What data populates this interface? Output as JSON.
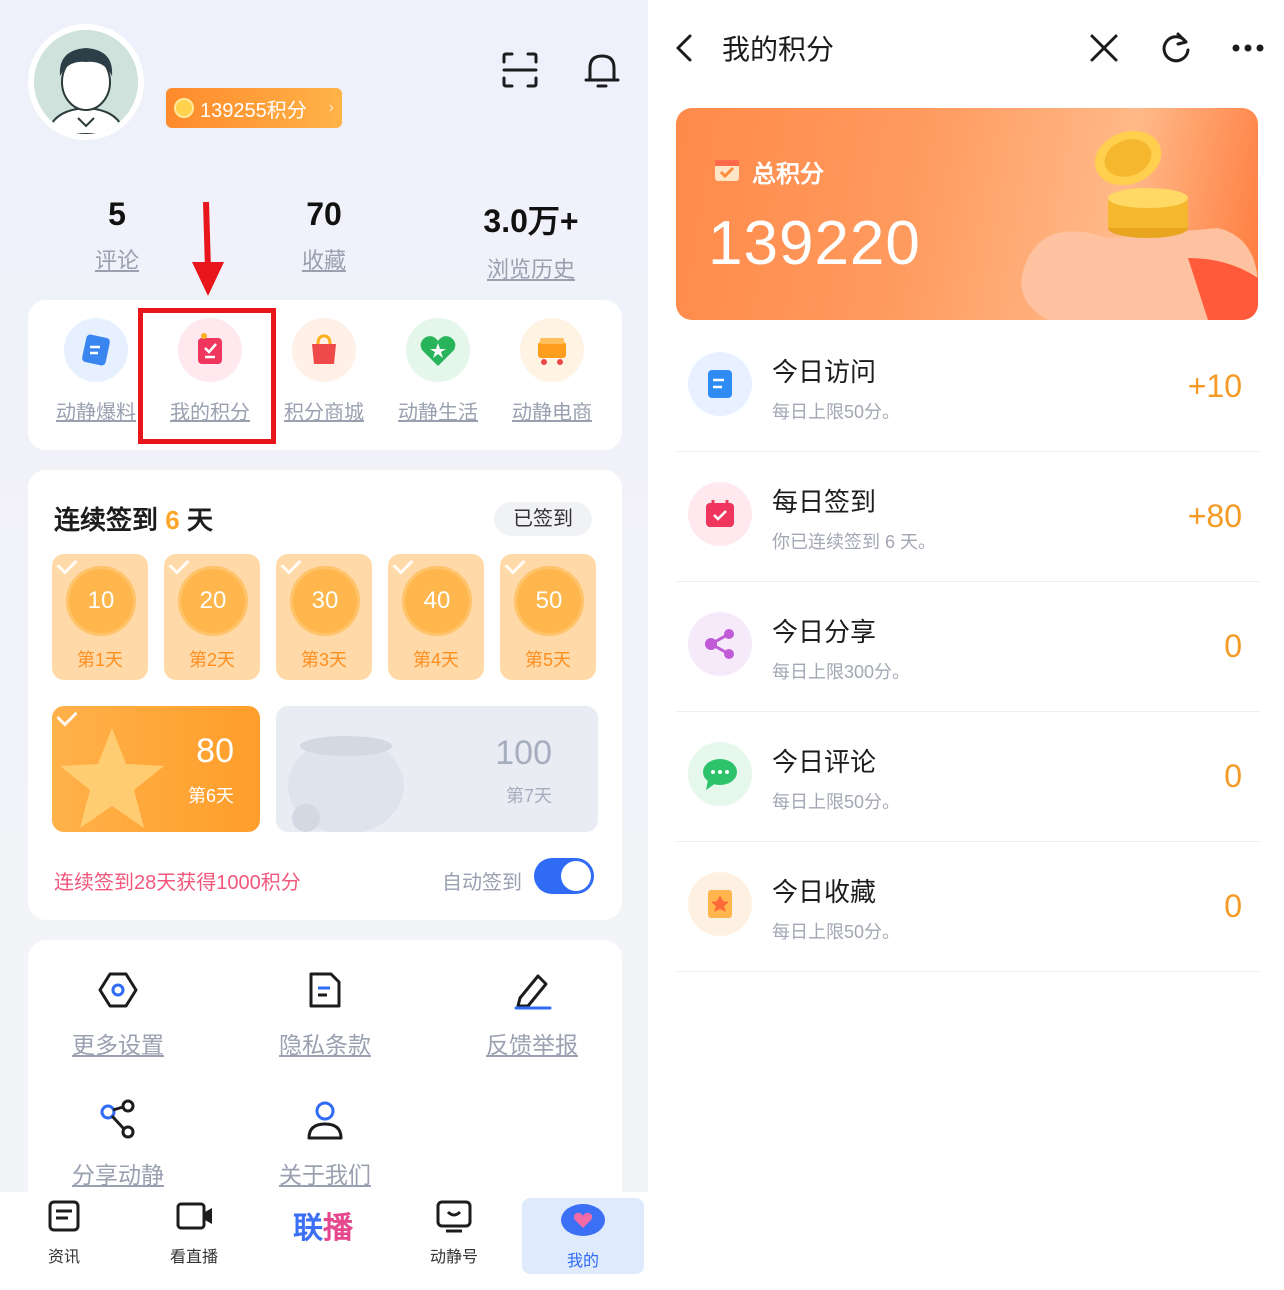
{
  "left": {
    "points_badge": "139255积分",
    "stats": [
      {
        "value": "5",
        "label": "评论"
      },
      {
        "value": "70",
        "label": "收藏"
      },
      {
        "value": "3.0万+",
        "label": "浏览历史"
      }
    ],
    "quick": [
      {
        "label": "动静爆料",
        "icon": "document-icon"
      },
      {
        "label": "我的积分",
        "icon": "points-icon"
      },
      {
        "label": "积分商城",
        "icon": "shopping-bag-icon"
      },
      {
        "label": "动静生活",
        "icon": "heart-star-icon"
      },
      {
        "label": "动静电商",
        "icon": "cart-icon"
      }
    ],
    "checkin": {
      "title_prefix": "连续签到",
      "days_count": "6",
      "title_suffix": "天",
      "signed_label": "已签到",
      "days": [
        {
          "value": "10",
          "label": "第1天"
        },
        {
          "value": "20",
          "label": "第2天"
        },
        {
          "value": "30",
          "label": "第3天"
        },
        {
          "value": "40",
          "label": "第4天"
        },
        {
          "value": "50",
          "label": "第5天"
        },
        {
          "value": "80",
          "label": "第6天"
        },
        {
          "value": "100",
          "label": "第7天"
        }
      ],
      "tip": "连续签到28天获得1000积分",
      "auto_label": "自动签到",
      "auto_on": true
    },
    "settings": [
      {
        "label": "更多设置",
        "icon": "hexagon-settings-icon"
      },
      {
        "label": "隐私条款",
        "icon": "document-icon"
      },
      {
        "label": "反馈举报",
        "icon": "pencil-icon"
      },
      {
        "label": "分享动静",
        "icon": "share-icon"
      },
      {
        "label": "关于我们",
        "icon": "person-icon"
      }
    ],
    "tabs": [
      {
        "label": "资讯"
      },
      {
        "label": "看直播"
      },
      {
        "label": "动静号"
      },
      {
        "label": "我的"
      }
    ],
    "lianbo": {
      "text1": "联",
      "text2": "播"
    }
  },
  "right": {
    "title": "我的积分",
    "total_label": "总积分",
    "total_value": "139220",
    "tasks": [
      {
        "name": "今日访问",
        "desc": "每日上限50分。",
        "value": "+10",
        "icon": "document-icon",
        "color": "#2f8cf5"
      },
      {
        "name": "每日签到",
        "desc": "你已连续签到 6 天。",
        "value": "+80",
        "icon": "calendar-icon",
        "color": "#f0365e"
      },
      {
        "name": "今日分享",
        "desc": "每日上限300分。",
        "value": "0",
        "icon": "share-icon",
        "color": "#c05ad6"
      },
      {
        "name": "今日评论",
        "desc": "每日上限50分。",
        "value": "0",
        "icon": "chat-icon",
        "color": "#2cc36b"
      },
      {
        "name": "今日收藏",
        "desc": "每日上限50分。",
        "value": "0",
        "icon": "star-icon",
        "color": "#ff8a3a"
      }
    ]
  }
}
